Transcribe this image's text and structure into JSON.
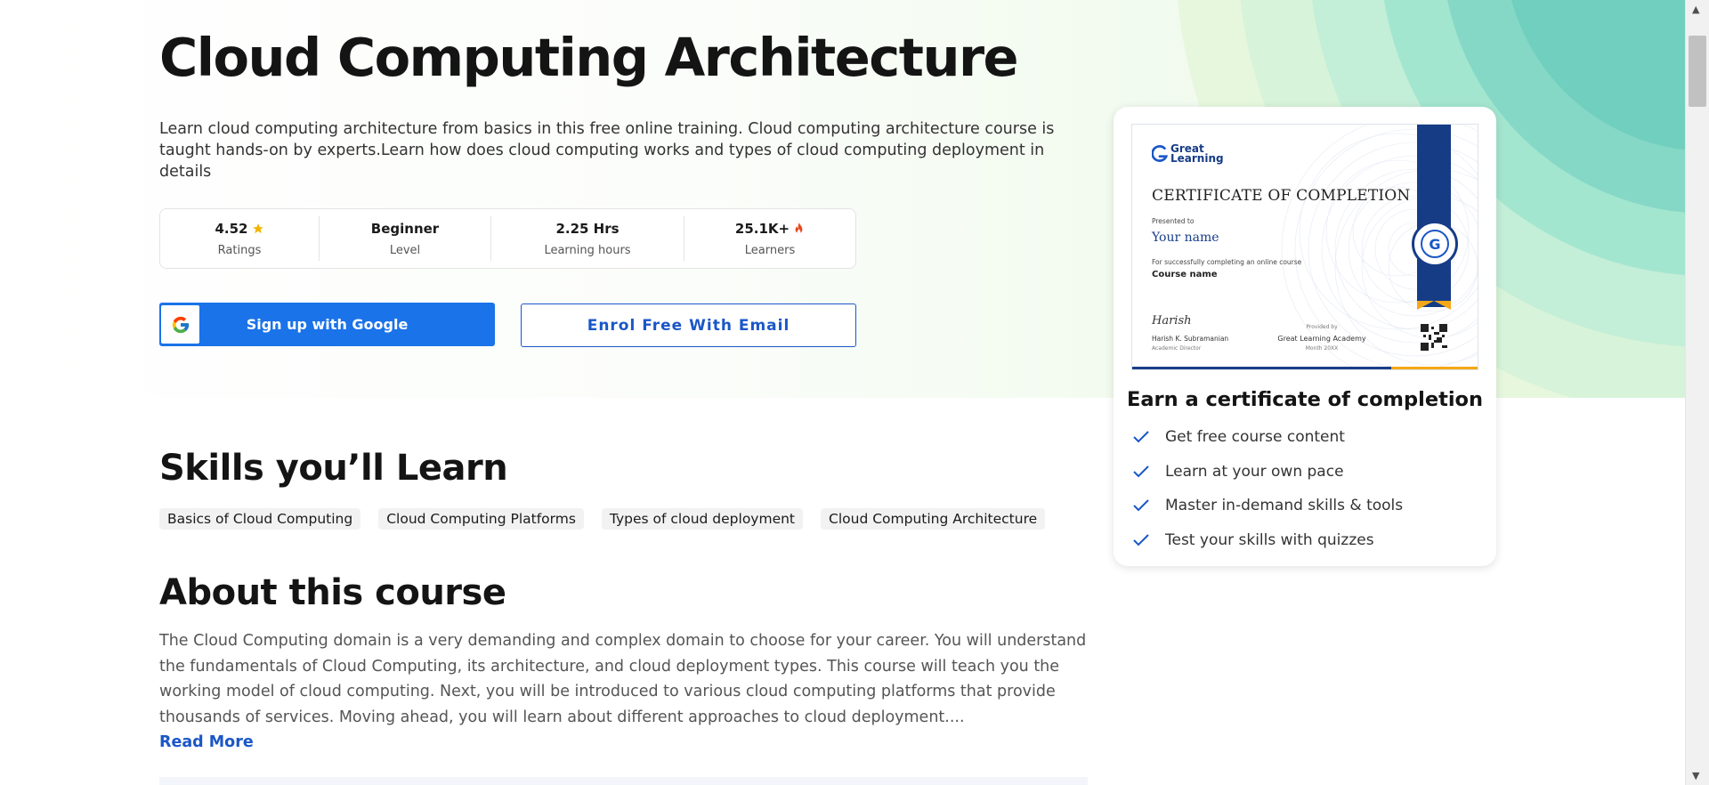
{
  "course": {
    "title": "Cloud Computing Architecture",
    "description": "Learn cloud computing architecture from basics in this free online training. Cloud computing architecture course is taught hands-on by experts.Learn how does cloud computing works and types of cloud computing deployment in details"
  },
  "stats": [
    {
      "value": "4.52",
      "label": "Ratings",
      "icon": "star-icon"
    },
    {
      "value": "Beginner",
      "label": "Level"
    },
    {
      "value": "2.25 Hrs",
      "label": "Learning hours"
    },
    {
      "value": "25.1K+",
      "label": "Learners",
      "icon": "fire-icon"
    }
  ],
  "buttons": {
    "google": "Sign up with Google",
    "email": "Enrol Free With Email"
  },
  "skills": {
    "heading": "Skills you’ll Learn",
    "items": [
      "Basics of Cloud Computing",
      "Cloud Computing Platforms",
      "Types of cloud deployment",
      "Cloud Computing Architecture"
    ]
  },
  "about": {
    "heading": "About this course",
    "text": "The Cloud Computing domain is a very demanding and complex domain to choose for your career. You will understand the fundamentals of Cloud Computing, its architecture, and cloud deployment types. This course will teach you the working model of cloud computing. Next, you will be introduced to various cloud computing platforms that provide thousands of services. Moving ahead, you will learn about different approaches to cloud deployment....",
    "read_more": "Read More"
  },
  "certificate": {
    "logo_line1": "Great",
    "logo_line2": "Learning",
    "title": "CERTIFICATE OF COMPLETION",
    "presented_to": "Presented to",
    "your_name": "Your name",
    "for_text": "For successfully completing an online course",
    "course_name": "Course name",
    "signature": "Harish",
    "signer": "Harish K. Subramanian",
    "signer_role": "Academic Director",
    "provided_by": "Provided by",
    "academy": "Great Learning Academy",
    "month": "Month 20XX",
    "seal_text": "G"
  },
  "earn": {
    "title": "Earn a certificate of completion",
    "benefits": [
      "Get free course content",
      "Learn at your own pace",
      "Master in-demand skills & tools",
      "Test your skills with quizzes"
    ]
  },
  "colors": {
    "primary": "#1a73e8",
    "link": "#1a57c7",
    "star": "#f4b400",
    "fire": "#e8471c",
    "check": "#1a57c7",
    "ribbon": "#163c86",
    "accent_gold": "#f4a817"
  }
}
